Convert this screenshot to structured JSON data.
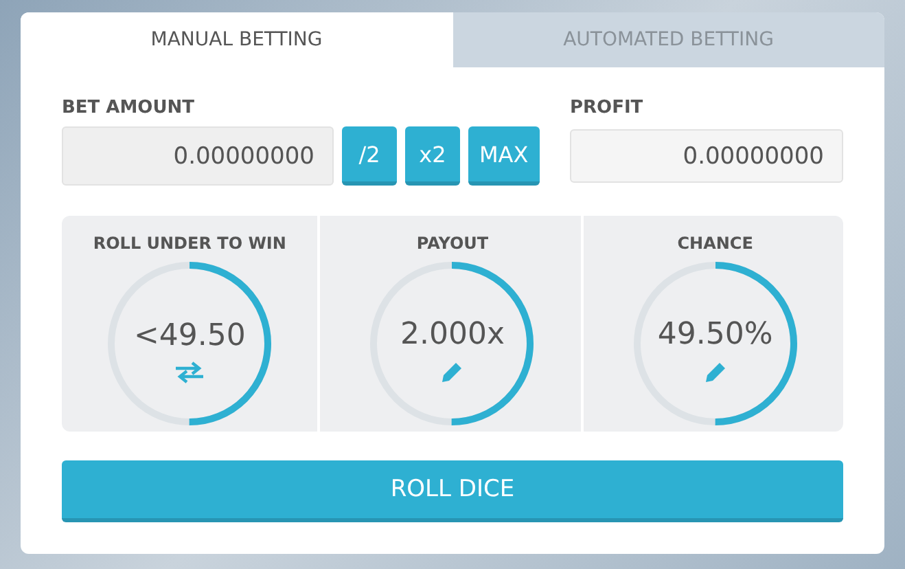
{
  "tabs": [
    {
      "label": "MANUAL BETTING",
      "selected": true
    },
    {
      "label": "AUTOMATED BETTING",
      "selected": false
    }
  ],
  "bet": {
    "label": "BET AMOUNT",
    "value": "0.00000000",
    "buttons": [
      "/2",
      "x2",
      "MAX"
    ]
  },
  "profit": {
    "label": "PROFIT",
    "value": "0.00000000"
  },
  "stats": [
    {
      "label": "ROLL UNDER TO WIN",
      "value": "<49.50",
      "level": 0.5,
      "kind": "swap"
    },
    {
      "label": "PAYOUT",
      "value": "2.000x",
      "level": 0.5,
      "kind": "edit"
    },
    {
      "label": "CHANCE",
      "value": "49.50%",
      "level": 0.5,
      "kind": "edit"
    }
  ],
  "action": "ROLL DICE"
}
